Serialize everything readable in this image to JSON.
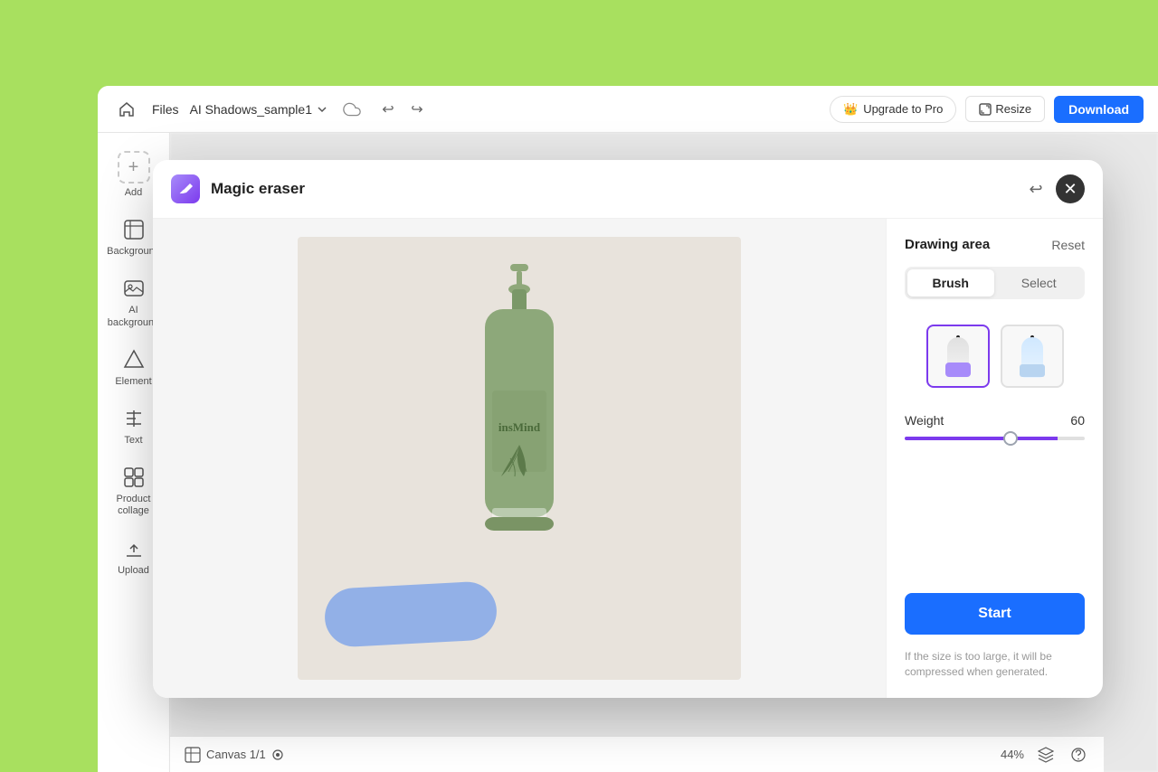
{
  "toolbar": {
    "files_label": "Files",
    "project_name": "AI Shadows_sample1",
    "upgrade_label": "Upgrade to Pro",
    "resize_label": "Resize",
    "download_label": "Download"
  },
  "sidebar": {
    "items": [
      {
        "label": "Add",
        "icon": "plus-icon"
      },
      {
        "label": "Background",
        "icon": "background-icon"
      },
      {
        "label": "AI background",
        "icon": "ai-background-icon"
      },
      {
        "label": "Element",
        "icon": "element-icon"
      },
      {
        "label": "Text",
        "icon": "text-icon"
      },
      {
        "label": "Product collage",
        "icon": "collage-icon"
      },
      {
        "label": "Upload",
        "icon": "upload-icon"
      }
    ]
  },
  "modal": {
    "title": "Magic eraser",
    "drawing_area_label": "Drawing area",
    "reset_label": "Reset",
    "tabs": {
      "brush_label": "Brush",
      "select_label": "Select"
    },
    "weight_label": "Weight",
    "weight_value": "60",
    "start_label": "Start",
    "hint_text": "If the size is too large, it will be compressed when generated."
  },
  "bottom_bar": {
    "canvas_label": "Canvas 1/1",
    "zoom_label": "44%"
  },
  "colors": {
    "primary": "#1a6eff",
    "accent": "#7c3aed",
    "brush_stroke": "rgba(100,149,237,0.65)"
  }
}
